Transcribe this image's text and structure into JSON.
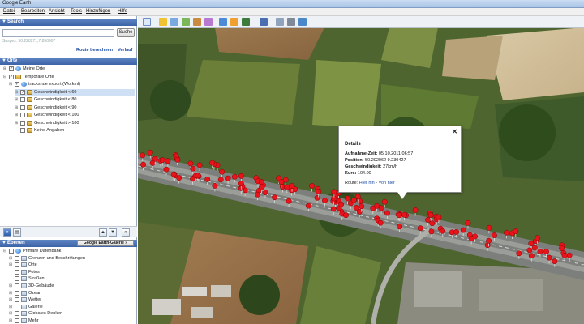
{
  "window": {
    "title": "Google Earth"
  },
  "menu": {
    "items": [
      "Datei",
      "Bearbeiten",
      "Ansicht",
      "Tools",
      "Hinzufügen",
      "Hilfe"
    ]
  },
  "search": {
    "header": "Search",
    "button": "Suche",
    "coordinates": "Suspes: 50.228271,7.850907",
    "route_link": "Route berechnen",
    "history_link": "Verlauf"
  },
  "places": {
    "header": "Orte",
    "items": [
      {
        "label": "Meine Orte",
        "icon": "globe-icon",
        "checked": true,
        "level": 0,
        "expand": "⊞"
      },
      {
        "label": "Temporäre Orte",
        "icon": "folder-icon",
        "checked": true,
        "level": 0,
        "expand": "⊟"
      },
      {
        "label": "tracksnde export (Wo.kml)",
        "icon": "globe-icon",
        "checked": true,
        "level": 1,
        "expand": "⊟"
      },
      {
        "label": "Geschwindigkeit < 60",
        "icon": "folder-icon",
        "checked": true,
        "level": 2,
        "expand": "⊞",
        "selected": true
      },
      {
        "label": "Geschwindigkeit < 80",
        "icon": "folder-icon",
        "checked": false,
        "level": 2,
        "expand": "⊞"
      },
      {
        "label": "Geschwindigkeit < 90",
        "icon": "folder-icon",
        "checked": false,
        "level": 2,
        "expand": "⊞"
      },
      {
        "label": "Geschwindigkeit < 100",
        "icon": "folder-icon",
        "checked": false,
        "level": 2,
        "expand": "⊞"
      },
      {
        "label": "Geschwindigkeit > 100",
        "icon": "folder-icon",
        "checked": false,
        "level": 2,
        "expand": "⊞"
      },
      {
        "label": "Keine Angaben",
        "icon": "folder-icon",
        "checked": false,
        "level": 2,
        "expand": ""
      }
    ]
  },
  "layers": {
    "header": "Ebenen",
    "gallery_button": "Google Earth-Galerie »",
    "items": [
      {
        "label": "Primäre Datenbank",
        "icon": "globe-icon",
        "expand": "⊟",
        "level": 0
      },
      {
        "label": "Grenzen und Beschriftungen",
        "icon": "layer-icon",
        "expand": "⊞",
        "level": 1
      },
      {
        "label": "Orte",
        "icon": "layer-icon",
        "expand": "⊞",
        "level": 1
      },
      {
        "label": "Fotos",
        "icon": "layer-icon",
        "expand": "",
        "level": 1
      },
      {
        "label": "Straßen",
        "icon": "layer-icon",
        "expand": "",
        "level": 1
      },
      {
        "label": "3D-Gebäude",
        "icon": "layer-icon",
        "expand": "⊞",
        "level": 1
      },
      {
        "label": "Ozean",
        "icon": "layer-icon",
        "expand": "⊞",
        "level": 1
      },
      {
        "label": "Wetter",
        "icon": "layer-icon",
        "expand": "⊞",
        "level": 1
      },
      {
        "label": "Galerie",
        "icon": "layer-icon",
        "expand": "⊞",
        "level": 1
      },
      {
        "label": "Globales Denken",
        "icon": "layer-icon",
        "expand": "⊞",
        "level": 1
      },
      {
        "label": "Mehr",
        "icon": "layer-icon",
        "expand": "⊞",
        "level": 1
      }
    ]
  },
  "balloon": {
    "title": "Details",
    "close": "✕",
    "rows": [
      {
        "key": "Aufnahme-Zeit:",
        "value": "05.10.2011 06:57"
      },
      {
        "key": "Position:",
        "value": "50.202062 9.230427"
      },
      {
        "key": "Geschwindigkeit:",
        "value": "27km/h"
      },
      {
        "key": "Kurs:",
        "value": "104.00"
      }
    ],
    "route_label": "Route:",
    "route_here": "Hier hin",
    "route_sep": " - ",
    "route_from": "Von hier"
  },
  "colors": {
    "accent": "#3c63a6",
    "marker": "#e8141c",
    "link": "#1f4ea8"
  }
}
